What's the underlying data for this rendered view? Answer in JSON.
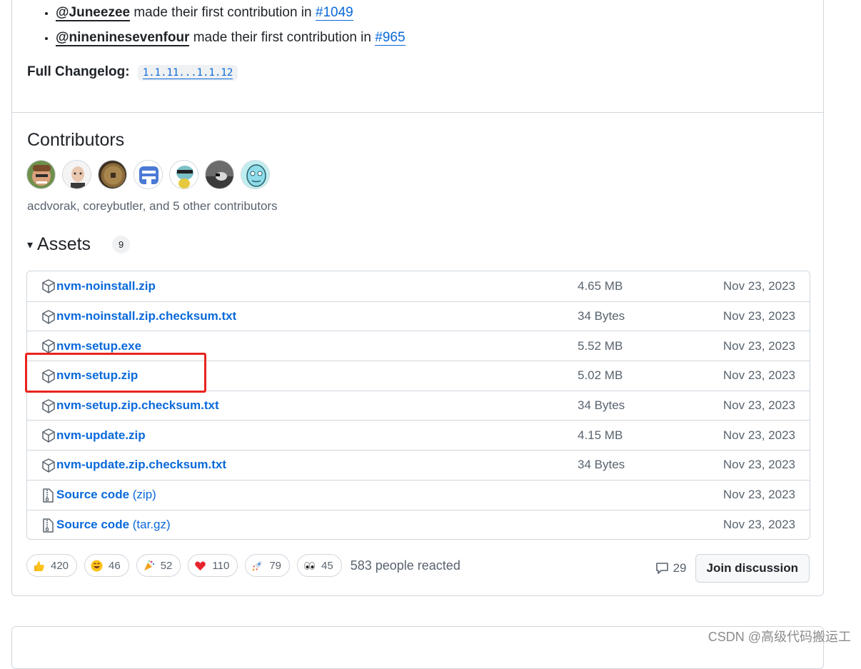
{
  "release": {
    "new_contributors": [
      {
        "user": "@Juneezee",
        "text": "made their first contribution in",
        "pr": "#1049"
      },
      {
        "user": "@nineninesevenfour",
        "text": "made their first contribution in",
        "pr": "#965"
      }
    ],
    "changelog_label": "Full Changelog",
    "changelog_sep": ":",
    "changelog_link": "1.1.11...1.1.12"
  },
  "contributors": {
    "title": "Contributors",
    "avatars": [
      "acdvorak",
      "coreybutler",
      "contributor-3",
      "contributor-4",
      "contributor-5",
      "contributor-6",
      "contributor-7"
    ],
    "summary": "acdvorak, coreybutler, and 5 other contributors"
  },
  "assets": {
    "caret": "▾",
    "title": "Assets",
    "count": "9",
    "items": [
      {
        "name": "nvm-noinstall.zip",
        "ext": "",
        "size": "4.65 MB",
        "date": "Nov 23, 2023",
        "icon": "package-icon"
      },
      {
        "name": "nvm-noinstall.zip.checksum.txt",
        "ext": "",
        "size": "34 Bytes",
        "date": "Nov 23, 2023",
        "icon": "package-icon"
      },
      {
        "name": "nvm-setup.exe",
        "ext": "",
        "size": "5.52 MB",
        "date": "Nov 23, 2023",
        "icon": "package-icon"
      },
      {
        "name": "nvm-setup.zip",
        "ext": "",
        "size": "5.02 MB",
        "date": "Nov 23, 2023",
        "icon": "package-icon"
      },
      {
        "name": "nvm-setup.zip.checksum.txt",
        "ext": "",
        "size": "34 Bytes",
        "date": "Nov 23, 2023",
        "icon": "package-icon"
      },
      {
        "name": "nvm-update.zip",
        "ext": "",
        "size": "4.15 MB",
        "date": "Nov 23, 2023",
        "icon": "package-icon"
      },
      {
        "name": "nvm-update.zip.checksum.txt",
        "ext": "",
        "size": "34 Bytes",
        "date": "Nov 23, 2023",
        "icon": "package-icon"
      },
      {
        "name": "Source code",
        "ext": " (zip)",
        "size": "",
        "date": "Nov 23, 2023",
        "icon": "file-zip-icon"
      },
      {
        "name": "Source code",
        "ext": " (tar.gz)",
        "size": "",
        "date": "Nov 23, 2023",
        "icon": "file-zip-icon"
      }
    ]
  },
  "reactions": {
    "items": [
      {
        "emoji": "thumbs-up-icon",
        "count": "420"
      },
      {
        "emoji": "laugh-icon",
        "count": "46"
      },
      {
        "emoji": "hooray-icon",
        "count": "52"
      },
      {
        "emoji": "heart-icon",
        "count": "110"
      },
      {
        "emoji": "rocket-icon",
        "count": "79"
      },
      {
        "emoji": "eyes-icon",
        "count": "45"
      }
    ],
    "summary": "583 people reacted"
  },
  "discussion": {
    "comment_count": "29",
    "join_label": "Join discussion"
  },
  "highlight_color": "#e8241d",
  "watermark": "CSDN @高级代码搬运工"
}
